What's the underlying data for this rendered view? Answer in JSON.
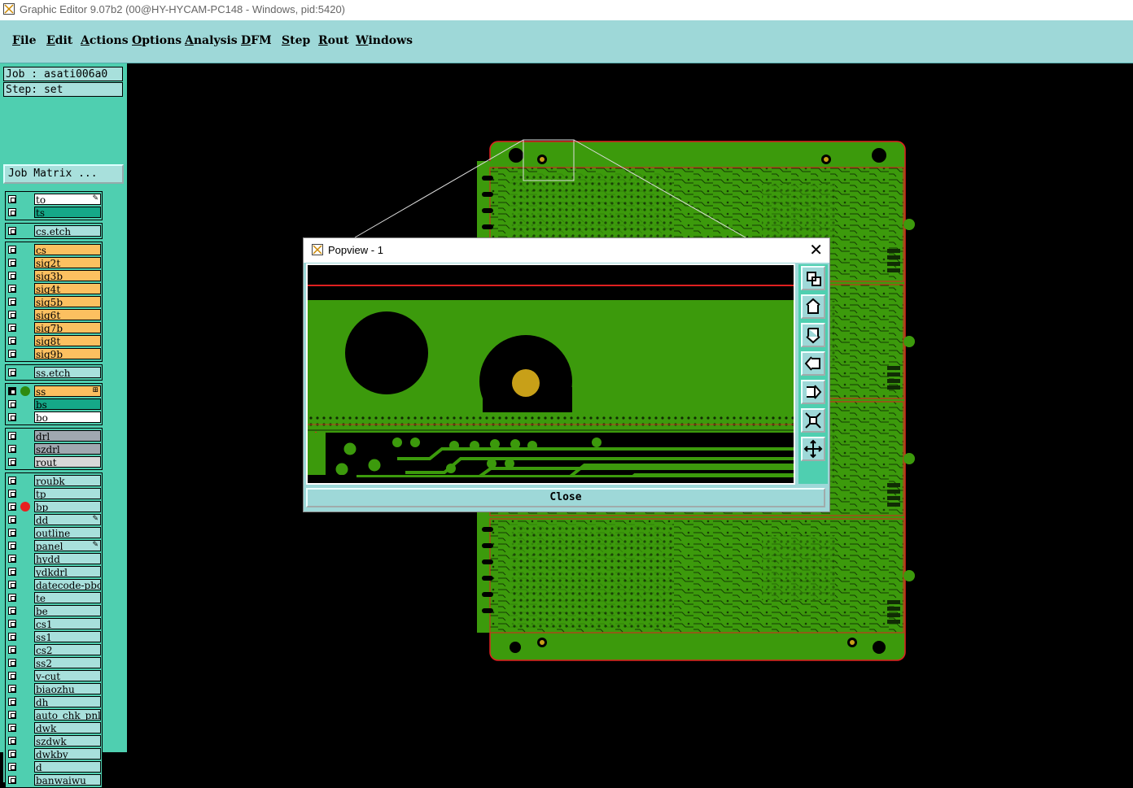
{
  "window": {
    "title": "Graphic Editor 9.07b2 (00@HY-HYCAM-PC148 - Windows, pid:5420)"
  },
  "menu": [
    {
      "label": "File"
    },
    {
      "label": "Edit"
    },
    {
      "label": "Actions"
    },
    {
      "label": "Options"
    },
    {
      "label": "Analysis"
    },
    {
      "label": "DFM"
    },
    {
      "label": "Step"
    },
    {
      "label": "Rout"
    },
    {
      "label": "Windows"
    }
  ],
  "job": {
    "label": "Job : asati006a0",
    "step": "Step: set",
    "matrix_button": "Job Matrix ..."
  },
  "colors": {
    "orange": "#fcc060",
    "teal": "#15a888",
    "light": "#a8e0dc",
    "white": "#ffffff",
    "gray": "#a0a8b0",
    "lightgray": "#d8d8d8",
    "pcb": "#3c9a0c",
    "pcb_dark": "#2e7a08",
    "pad": "#c8a018",
    "outline_red": "#e02020"
  },
  "layer_groups": [
    {
      "rows": [
        {
          "name": "to",
          "color": "white",
          "mark": "pen-icon"
        },
        {
          "name": "ts",
          "color": "teal"
        }
      ]
    },
    {
      "rows": [
        {
          "name": "cs.etch",
          "color": "light"
        }
      ]
    },
    {
      "rows": [
        {
          "name": "cs",
          "color": "orange"
        },
        {
          "name": "sig2t",
          "color": "orange"
        },
        {
          "name": "sig3b",
          "color": "orange"
        },
        {
          "name": "sig4t",
          "color": "orange"
        },
        {
          "name": "sig5b",
          "color": "orange"
        },
        {
          "name": "sig6t",
          "color": "orange"
        },
        {
          "name": "sig7b",
          "color": "orange"
        },
        {
          "name": "sig8t",
          "color": "orange"
        },
        {
          "name": "sig9b",
          "color": "orange"
        }
      ]
    },
    {
      "rows": [
        {
          "name": "ss.etch",
          "color": "light"
        }
      ]
    },
    {
      "rows": [
        {
          "name": "ss",
          "color": "orange",
          "indicator": "#2e8a10",
          "checked": true,
          "mark": "grid-icon"
        },
        {
          "name": "bs",
          "color": "teal"
        },
        {
          "name": "bo",
          "color": "white"
        }
      ]
    },
    {
      "rows": [
        {
          "name": "drl",
          "color": "gray"
        },
        {
          "name": "szdrl",
          "color": "gray"
        },
        {
          "name": "rout",
          "color": "lightgray"
        }
      ]
    },
    {
      "rows": [
        {
          "name": "roubk",
          "color": "light"
        },
        {
          "name": "tp",
          "color": "light"
        },
        {
          "name": "bp",
          "color": "light",
          "indicator": "#e82020"
        },
        {
          "name": "dd",
          "color": "light",
          "mark": "pen-icon"
        },
        {
          "name": "outline",
          "color": "light"
        },
        {
          "name": "panel",
          "color": "light",
          "mark": "pen-icon"
        },
        {
          "name": "hydd",
          "color": "light"
        },
        {
          "name": "ydkdrl",
          "color": "light"
        },
        {
          "name": "datecode-pbo",
          "color": "light"
        },
        {
          "name": "te",
          "color": "light"
        },
        {
          "name": "be",
          "color": "light"
        },
        {
          "name": "cs1",
          "color": "light"
        },
        {
          "name": "ss1",
          "color": "light"
        },
        {
          "name": "cs2",
          "color": "light"
        },
        {
          "name": "ss2",
          "color": "light"
        },
        {
          "name": "v-cut",
          "color": "light"
        },
        {
          "name": "biaozhu",
          "color": "light"
        },
        {
          "name": "dh",
          "color": "light"
        },
        {
          "name": "auto_chk_pnl",
          "color": "light"
        },
        {
          "name": "dwk",
          "color": "light"
        },
        {
          "name": "szdwk",
          "color": "light"
        },
        {
          "name": "dwkby",
          "color": "light"
        },
        {
          "name": "d",
          "color": "light"
        },
        {
          "name": "banwaiwu",
          "color": "light"
        }
      ]
    }
  ],
  "popview": {
    "title": "Popview - 1",
    "close_label": "Close",
    "tools": [
      {
        "icon": "zoom-window-icon"
      },
      {
        "icon": "pan-up-icon"
      },
      {
        "icon": "pan-down-icon"
      },
      {
        "icon": "pan-left-icon"
      },
      {
        "icon": "pan-right-icon"
      },
      {
        "icon": "zoom-in-icon"
      },
      {
        "icon": "zoom-out-icon"
      }
    ]
  }
}
